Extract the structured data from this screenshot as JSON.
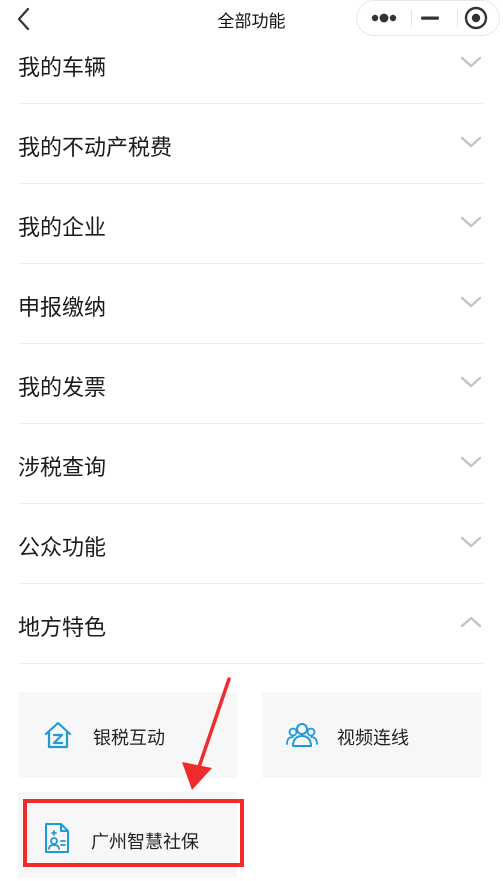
{
  "header": {
    "title": "全部功能"
  },
  "menu": [
    {
      "label": "我的车辆",
      "expanded": false
    },
    {
      "label": "我的不动产税费",
      "expanded": false
    },
    {
      "label": "我的企业",
      "expanded": false
    },
    {
      "label": "申报缴纳",
      "expanded": false
    },
    {
      "label": "我的发票",
      "expanded": false
    },
    {
      "label": "涉税查询",
      "expanded": false
    },
    {
      "label": "公众功能",
      "expanded": false
    },
    {
      "label": "地方特色",
      "expanded": true
    }
  ],
  "local_features": [
    {
      "label": "银税互动",
      "icon": "house-z-icon"
    },
    {
      "label": "视频连线",
      "icon": "users-icon"
    },
    {
      "label": "广州智慧社保",
      "icon": "social-security-doc-icon"
    }
  ],
  "colors": {
    "accent_blue": "#1e9bd7",
    "highlight_red": "#ef2b2b",
    "chevron_gray": "#c4c4c4"
  }
}
